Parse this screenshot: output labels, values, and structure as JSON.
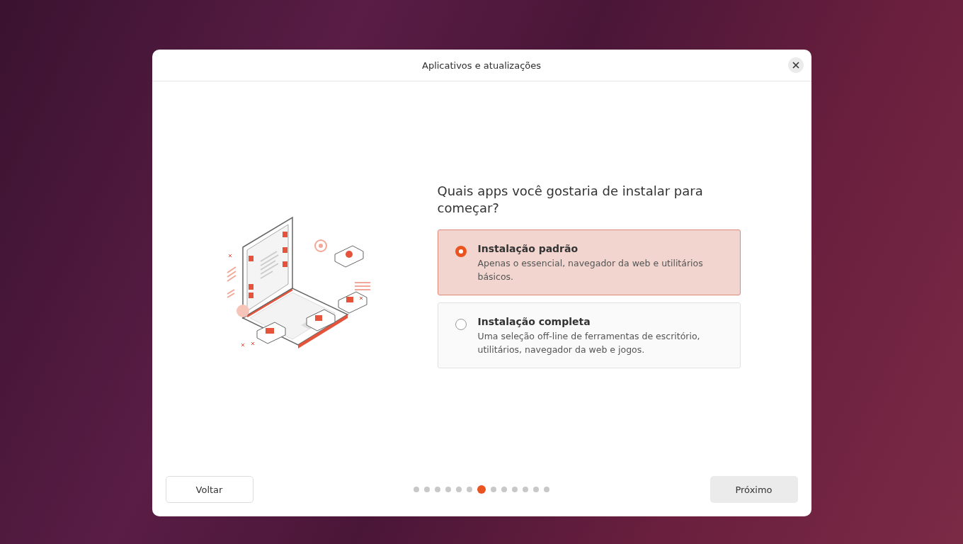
{
  "window": {
    "title": "Aplicativos e atualizações"
  },
  "question": "Quais apps você gostaria de instalar para começar?",
  "options": [
    {
      "title": "Instalação padrão",
      "description": "Apenas o essencial, navegador da web e utilitários básicos.",
      "selected": true
    },
    {
      "title": "Instalação completa",
      "description": "Uma seleção off-line de ferramentas de escritório, utilitários, navegador da web e jogos.",
      "selected": false
    }
  ],
  "buttons": {
    "back": "Voltar",
    "next": "Próximo"
  },
  "steps": [
    {
      "selected": false
    },
    {
      "selected": false
    },
    {
      "selected": false
    },
    {
      "selected": false
    },
    {
      "selected": false
    },
    {
      "selected": false
    },
    {
      "selected": true
    },
    {
      "selected": false
    },
    {
      "selected": false
    },
    {
      "selected": false
    },
    {
      "selected": false
    },
    {
      "selected": false
    },
    {
      "selected": false
    }
  ]
}
